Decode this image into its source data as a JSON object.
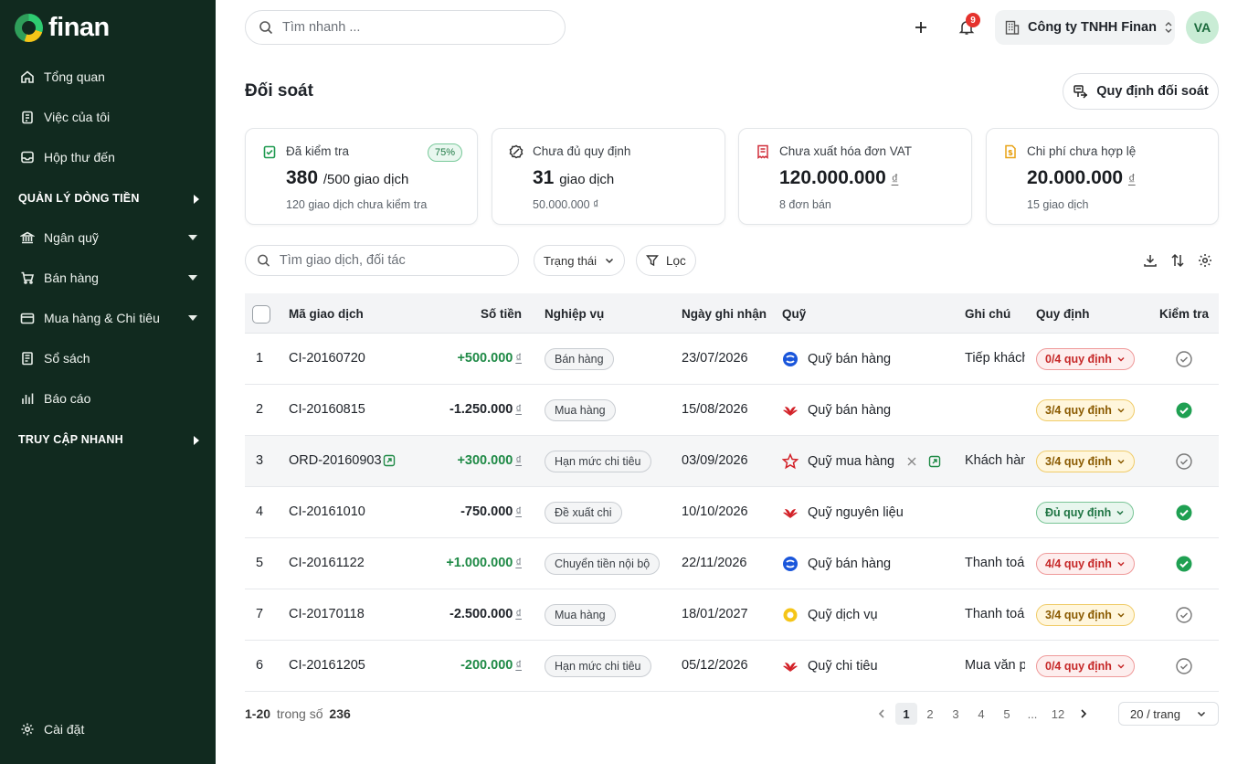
{
  "sidebar": {
    "logo_text": "finan",
    "items": [
      {
        "label": "Tổng quan",
        "icon": "home-icon"
      },
      {
        "label": "Việc của tôi",
        "icon": "clipboard-icon"
      },
      {
        "label": "Hộp thư đến",
        "icon": "inbox-icon"
      }
    ],
    "section_cashflow": "QUẢN LÝ DÒNG TIỀN",
    "cashflow_items": [
      {
        "label": "Ngân quỹ",
        "icon": "bank-icon"
      },
      {
        "label": "Bán hàng",
        "icon": "cart-icon"
      },
      {
        "label": "Mua hàng & Chi tiêu",
        "icon": "wallet-icon"
      },
      {
        "label": "Sổ sách",
        "icon": "book-icon"
      },
      {
        "label": "Báo cáo",
        "icon": "chart-icon"
      }
    ],
    "section_quick": "TRUY CẬP NHANH",
    "settings_label": "Cài đặt"
  },
  "header": {
    "search_placeholder": "Tìm nhanh ...",
    "notification_count": "9",
    "company": "Công ty TNHH Finan",
    "avatar": "VA"
  },
  "page": {
    "title": "Đối soát",
    "rules_button": "Quy định đối soát"
  },
  "cards": [
    {
      "title": "Đã kiểm tra",
      "big": "380",
      "unit": "/500 giao dịch",
      "sub": "120 giao dịch chưa kiểm tra",
      "badge": "75%"
    },
    {
      "title": "Chưa đủ quy định",
      "big": "31",
      "unit": "giao dịch",
      "sub": "50.000.000 ₫"
    },
    {
      "title": "Chưa xuất hóa đơn VAT",
      "big": "120.000.000",
      "unit": "₫",
      "sub": "8 đơn bán"
    },
    {
      "title": "Chi phí chưa hợp lệ",
      "big": "20.000.000",
      "unit": "₫",
      "sub": "15 giao dịch"
    }
  ],
  "filters": {
    "search_placeholder": "Tìm giao dịch, đối tác",
    "status_label": "Trạng thái",
    "filter_label": "Lọc"
  },
  "table": {
    "headers": [
      "Mã giao dịch",
      "Số tiền",
      "Nghiệp vụ",
      "Ngày ghi nhận",
      "Quỹ",
      "Ghi chú",
      "Quy định",
      "Kiểm tra"
    ],
    "currency": "₫",
    "rows": [
      {
        "no": "1",
        "code": "CI-20160720",
        "amount": "+500.000",
        "amount_color": "#1f8a46",
        "type": "Bán hàng",
        "date": "23/07/2026",
        "fund": "Quỹ bán hàng",
        "fund_icon": "blue",
        "note": "Tiếp khách",
        "rule": "0/4 quy định",
        "rule_color": "red",
        "checked": false
      },
      {
        "no": "2",
        "code": "CI-20160815",
        "amount": "-1.250.000",
        "amount_color": "#1f2329",
        "type": "Mua hàng",
        "date": "15/08/2026",
        "fund": "Quỹ bán hàng",
        "fund_icon": "red-leaf",
        "note": "",
        "rule": "3/4 quy định",
        "rule_color": "yellow",
        "checked": true
      },
      {
        "no": "3",
        "code": "ORD-20160903",
        "amount": "+300.000",
        "amount_color": "#1f8a46",
        "type": "Hạn mức chi tiêu",
        "date": "03/09/2026",
        "fund": "Quỹ mua hàng",
        "fund_icon": "red-outline",
        "note": "Khách hàng",
        "rule": "3/4 quy định",
        "rule_color": "yellow",
        "checked": false
      },
      {
        "no": "4",
        "code": "CI-20161010",
        "amount": "-750.000",
        "amount_color": "#1f2329",
        "type": "Đề xuất chi",
        "date": "10/10/2026",
        "fund": "Quỹ nguyên liệu",
        "fund_icon": "red-leaf",
        "note": "",
        "rule": "Đủ quy định",
        "rule_color": "green",
        "checked": true
      },
      {
        "no": "5",
        "code": "CI-20161122",
        "amount": "+1.000.000",
        "amount_color": "#1f8a46",
        "type": "Chuyển tiền nội bộ",
        "date": "22/11/2026",
        "fund": "Quỹ bán hàng",
        "fund_icon": "blue",
        "note": "Thanh toán",
        "rule": "4/4 quy định",
        "rule_color": "red",
        "checked": true
      },
      {
        "no": "7",
        "code": "CI-20170118",
        "amount": "-2.500.000",
        "amount_color": "#1f2329",
        "type": "Mua hàng",
        "date": "18/01/2027",
        "fund": "Quỹ dịch vụ",
        "fund_icon": "yellow",
        "note": "Thanh toán",
        "rule": "3/4 quy định",
        "rule_color": "yellow",
        "checked": false
      },
      {
        "no": "6",
        "code": "CI-20161205",
        "amount": "-200.000",
        "amount_color": "#1f8a46",
        "type": "Hạn mức chi tiêu",
        "date": "05/12/2026",
        "fund": "Quỹ chi tiêu",
        "fund_icon": "red-leaf",
        "note": "Mua văn phòng",
        "rule": "0/4 quy định",
        "rule_color": "red",
        "checked": false
      }
    ]
  },
  "footer": {
    "range": "1-20",
    "of_label": "trong số",
    "total": "236",
    "pages": [
      "1",
      "2",
      "3",
      "4",
      "5",
      "...",
      "12"
    ],
    "per_page": "20 / trang"
  }
}
